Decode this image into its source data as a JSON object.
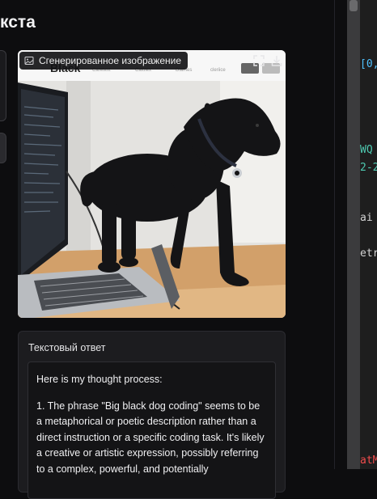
{
  "page": {
    "title": "кста"
  },
  "image_card": {
    "label": "Сгенерированное изображение",
    "label_icon": "image-icon",
    "fullscreen_icon": "fullscreen-icon",
    "download_icon": "download-icon",
    "photo_text": {
      "brand": "Black",
      "nav": [
        "Caretext",
        "Calolex",
        "Diames",
        "cleriice"
      ]
    }
  },
  "answer": {
    "title": "Текстовый ответ",
    "paragraphs": [
      "Here is my thought process:",
      "1. The phrase \"Big black dog coding\" seems to be a metaphorical or poetic description rather than a direct instruction or a specific coding task. It's likely a creative or artistic expression, possibly referring to a complex, powerful, and potentially"
    ]
  },
  "code_fragments": [
    "[0,",
    "WQ",
    "2-2",
    "ai",
    "etr",
    "atM"
  ],
  "colors": {
    "background": "#0d0d0f",
    "card": "#1c1c1f",
    "code_green": "#4ec9b0",
    "code_red": "#f14c4c"
  }
}
